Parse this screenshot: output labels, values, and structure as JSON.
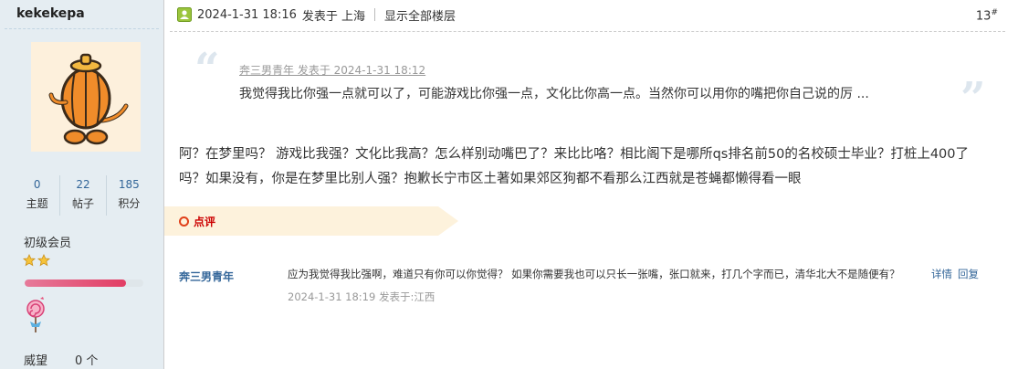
{
  "user": {
    "name": "kekekepa",
    "stats": [
      {
        "value": "0",
        "label": "主题"
      },
      {
        "value": "22",
        "label": "帖子"
      },
      {
        "value": "185",
        "label": "积分"
      }
    ],
    "group": "初级会员",
    "star_count": 2,
    "level_progress": 0.85,
    "prestige_label": "威望",
    "prestige_value": "0 个"
  },
  "post": {
    "date": "2024-1-31 18:16",
    "posted_in": "发表于 上海",
    "show_all": "显示全部楼层",
    "floor": "13",
    "floor_sup": "#",
    "quote_meta": "奔三男青年 发表于 2024-1-31 18:12",
    "quote_text": "我觉得我比你强一点就可以了，可能游戏比你强一点，文化比你高一点。当然你可以用你的嘴把你自己说的厉 ...",
    "body": "阿？在梦里吗？ 游戏比我强？文化比我高？怎么样别动嘴巴了？来比比咯？相比阁下是哪所qs排名前50的名校硕士毕业？打桩上400了吗？如果没有，你是在梦里比别人强？抱歉长宁市区土著如果郊区狗都不看那么江西就是苍蝇都懒得看一眼"
  },
  "comments": {
    "label": "点评",
    "items": [
      {
        "author": "奔三男青年",
        "text": "应为我觉得我比强啊，难道只有你可以你觉得？ 如果你需要我也可以只长一张嘴，张口就来，打几个字而已，清华北大不是随便有？",
        "detail": "详情",
        "reply": "回复",
        "time": "2024-1-31 18:19 发表于:江西"
      }
    ]
  },
  "colors": {
    "sidebar_bg": "#e5edf2",
    "link": "#336699",
    "comment_accent": "#cc0000"
  }
}
